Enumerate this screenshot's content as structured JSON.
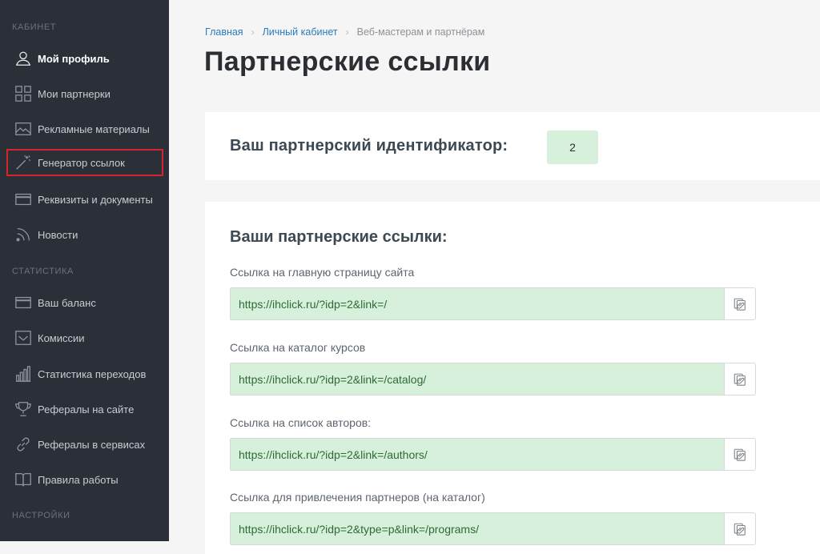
{
  "sidebar": {
    "sections": {
      "cabinet": "КАБИНЕТ",
      "stats": "СТАТИСТИКА",
      "settings": "НАСТРОЙКИ"
    },
    "items": [
      {
        "label": "Мой профиль",
        "icon": "user-icon"
      },
      {
        "label": "Мои партнерки",
        "icon": "grid-icon"
      },
      {
        "label": "Рекламные материалы",
        "icon": "image-icon"
      },
      {
        "label": "Генератор ссылок",
        "icon": "magic-wand-icon"
      },
      {
        "label": "Реквизиты и документы",
        "icon": "card-icon"
      },
      {
        "label": "Новости",
        "icon": "rss-icon"
      },
      {
        "label": "Ваш баланс",
        "icon": "wallet-icon"
      },
      {
        "label": "Комиссии",
        "icon": "envelope-icon"
      },
      {
        "label": "Статистика переходов",
        "icon": "bar-chart-icon"
      },
      {
        "label": "Рефералы на сайте",
        "icon": "trophy-icon"
      },
      {
        "label": "Рефералы в сервисах",
        "icon": "link-icon"
      },
      {
        "label": "Правила работы",
        "icon": "book-icon"
      }
    ]
  },
  "breadcrumb": {
    "home": "Главная",
    "cabinet": "Личный кабинет",
    "current": "Веб-мастерам и партнёрам"
  },
  "page_title": "Партнерские ссылки",
  "partner_id": {
    "label": "Ваш партнерский идентификатор:",
    "value": "2"
  },
  "links": {
    "title": "Ваши партнерские ссылки:",
    "items": [
      {
        "label": "Ссылка на главную страницу сайта",
        "url": "https://ihclick.ru/?idp=2&link=/"
      },
      {
        "label": "Ссылка на каталог курсов",
        "url": "https://ihclick.ru/?idp=2&link=/catalog/"
      },
      {
        "label": "Ссылка на список авторов:",
        "url": "https://ihclick.ru/?idp=2&link=/authors/"
      },
      {
        "label": "Ссылка для привлечения партнеров (на каталог)",
        "url": "https://ihclick.ru/?idp=2&type=p&link=/programs/"
      }
    ]
  },
  "colors": {
    "sidebar_bg": "#2a2f38",
    "link_bg": "#d6f0dc",
    "highlight_border": "#d2262b",
    "breadcrumb_link": "#2b7bb9"
  }
}
